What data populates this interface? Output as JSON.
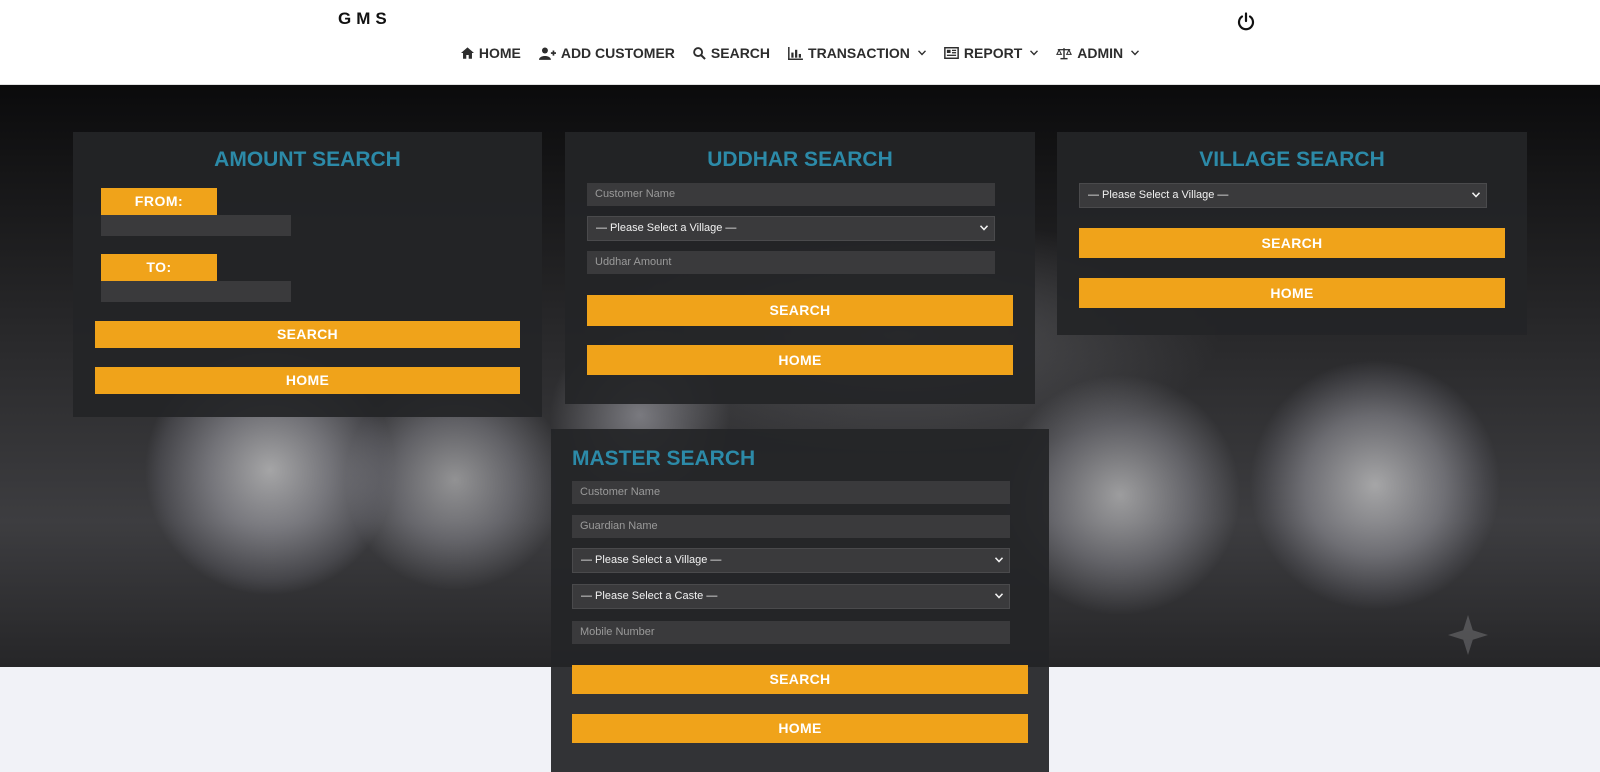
{
  "header": {
    "brand": "GMS",
    "nav": [
      {
        "label": "HOME",
        "icon": "home-icon",
        "dropdown": false
      },
      {
        "label": "ADD CUSTOMER",
        "icon": "add-user-icon",
        "dropdown": false
      },
      {
        "label": "SEARCH",
        "icon": "search-icon",
        "dropdown": false
      },
      {
        "label": "TRANSACTION",
        "icon": "bar-chart-icon",
        "dropdown": true
      },
      {
        "label": "REPORT",
        "icon": "report-icon",
        "dropdown": true
      },
      {
        "label": "ADMIN",
        "icon": "balance-scale-icon",
        "dropdown": true
      }
    ],
    "power_icon": "power-icon"
  },
  "colors": {
    "accent": "#f0a31a",
    "title": "#2c8aa8",
    "panel_bg": "#242527",
    "field_bg": "#3a3a3c"
  },
  "amount_search": {
    "title": "AMOUNT SEARCH",
    "from_label": "FROM:",
    "from_value": "",
    "to_label": "TO:",
    "to_value": "",
    "search_button": "SEARCH",
    "home_button": "HOME"
  },
  "uddhar_search": {
    "title": "UDDHAR SEARCH",
    "customer_placeholder": "Customer Name",
    "village_select": "— Please Select a Village —",
    "amount_placeholder": "Uddhar Amount",
    "search_button": "SEARCH",
    "home_button": "HOME"
  },
  "village_search": {
    "title": "VILLAGE SEARCH",
    "village_select": "— Please Select a Village —",
    "search_button": "SEARCH",
    "home_button": "HOME"
  },
  "master_search": {
    "title": "MASTER SEARCH",
    "customer_placeholder": "Customer Name",
    "guardian_placeholder": "Guardian Name",
    "village_select": "— Please Select a Village —",
    "caste_select": "— Please Select a Caste —",
    "mobile_placeholder": "Mobile Number",
    "search_button": "SEARCH",
    "home_button": "HOME"
  }
}
